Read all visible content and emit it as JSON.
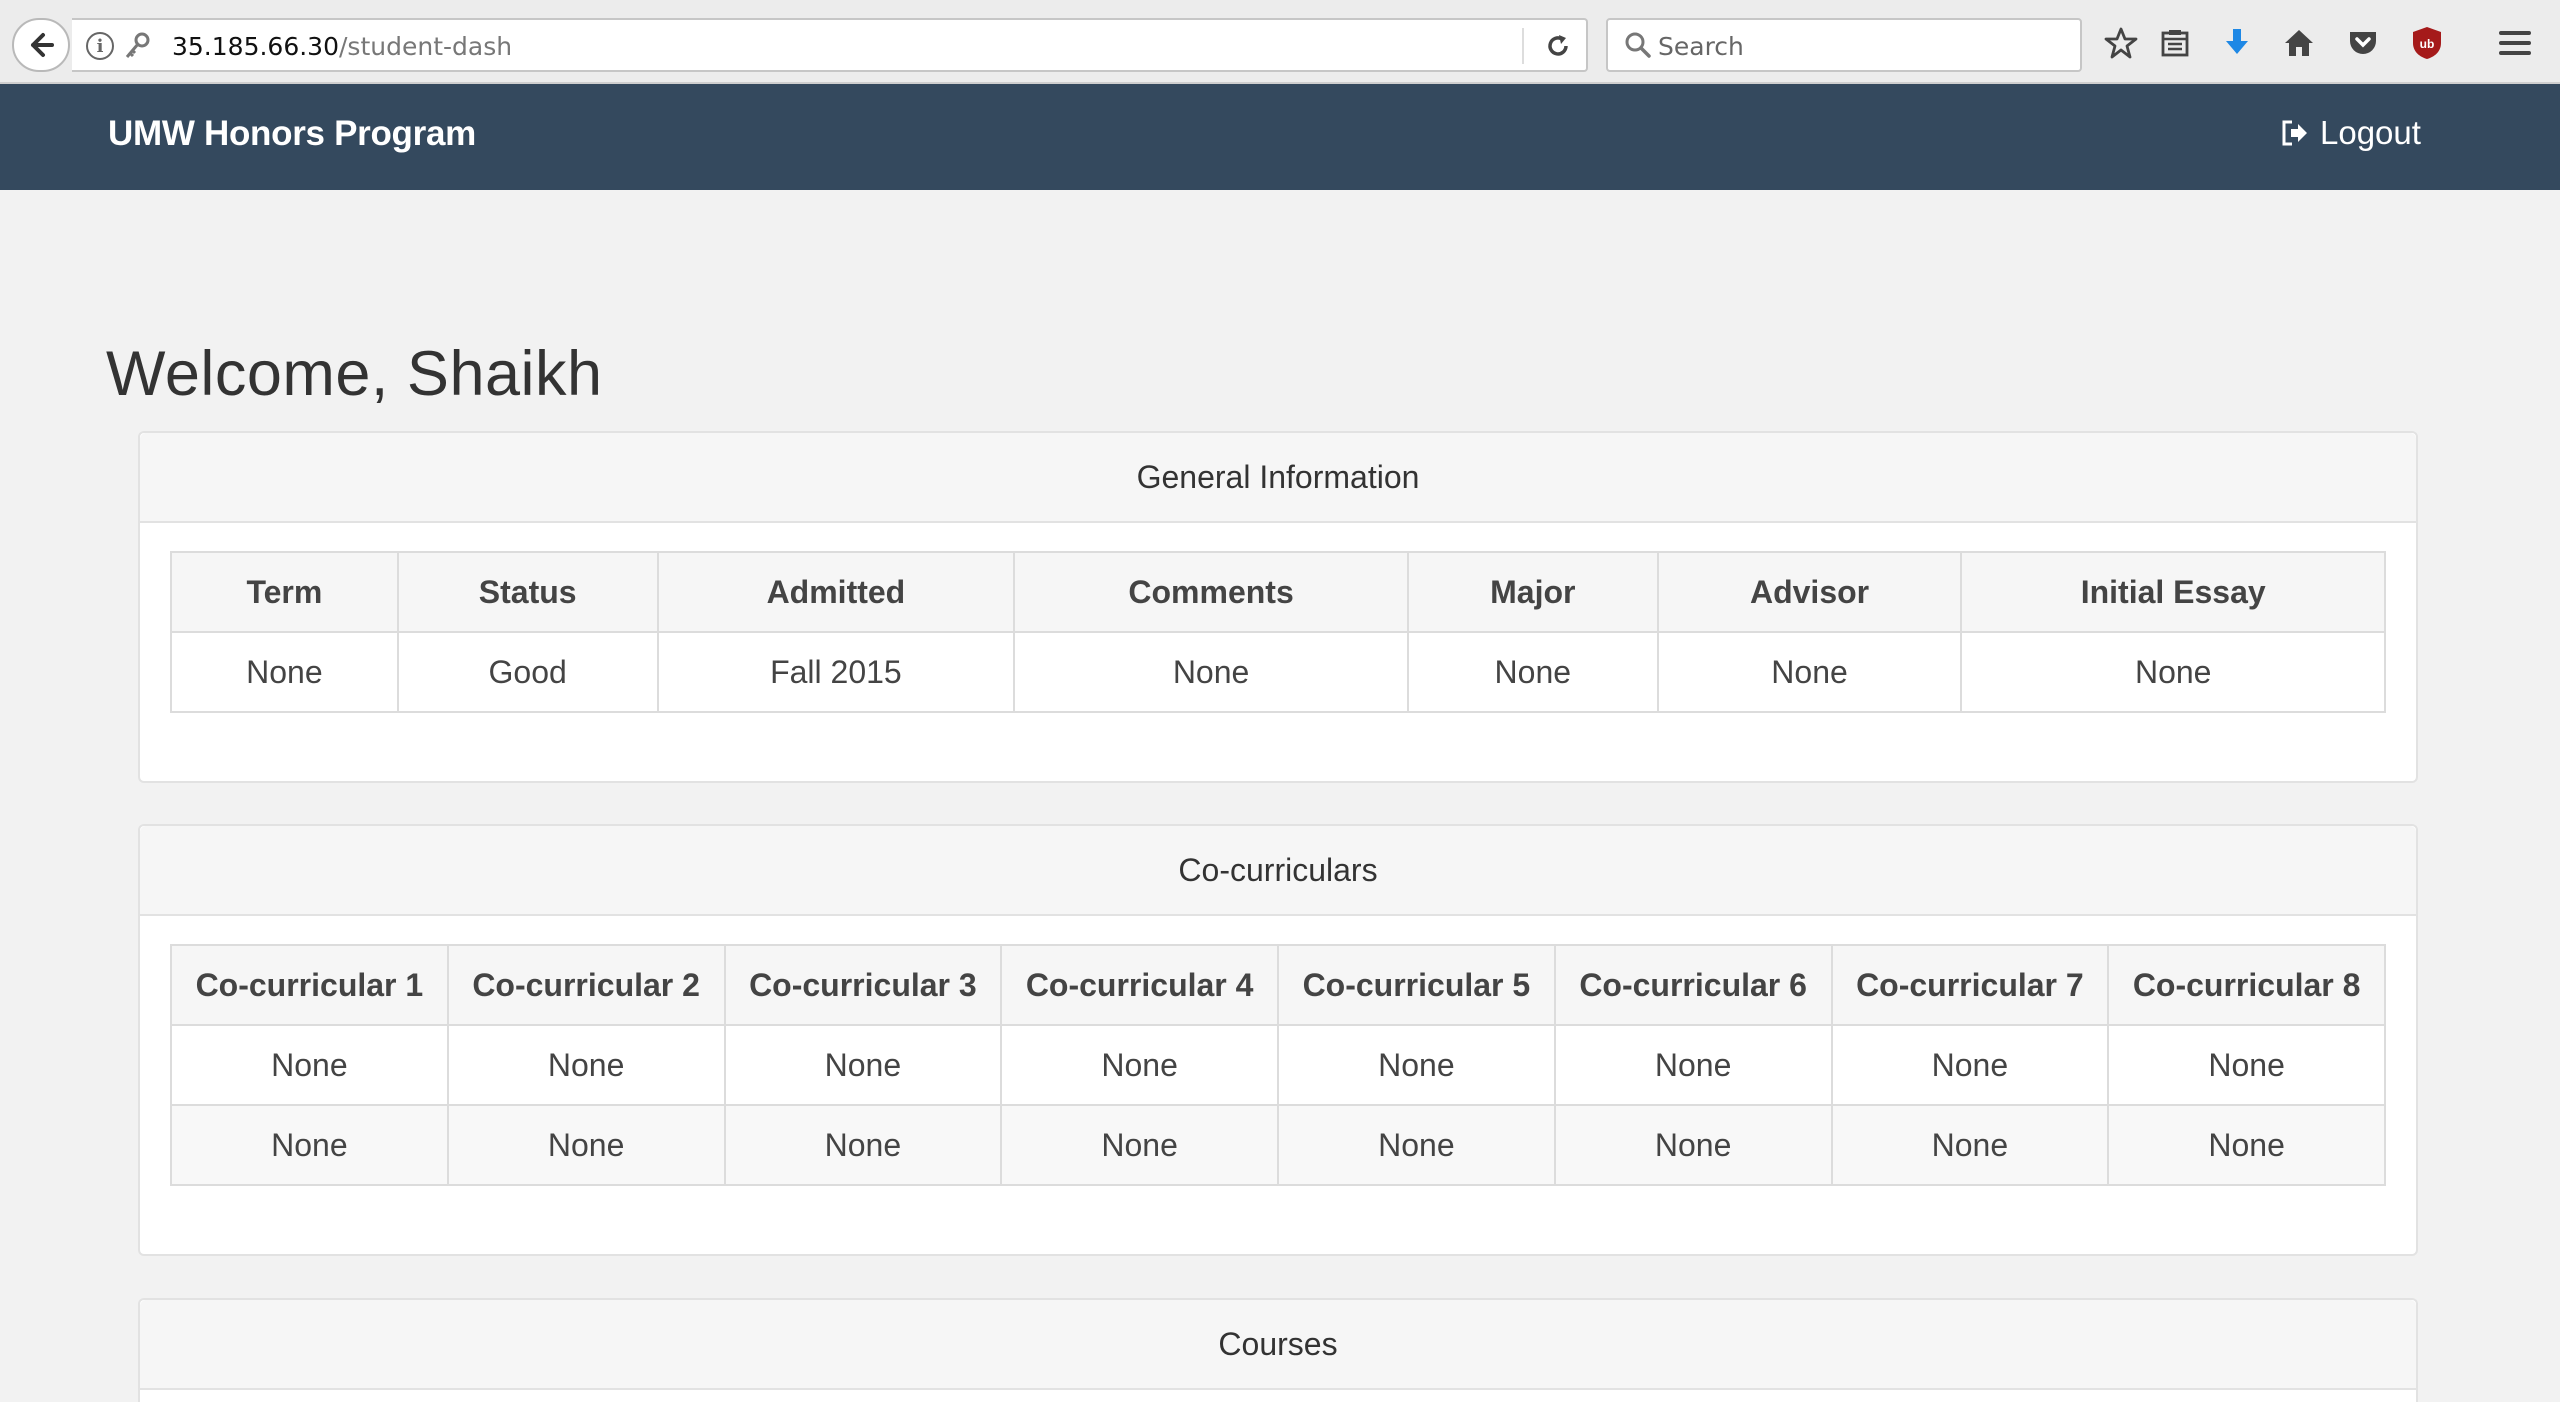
{
  "browser": {
    "url_host": "35.185.66.30",
    "url_path": "/student-dash",
    "search_placeholder": "Search",
    "toolbar_icons": [
      "star-icon",
      "reading-list-icon",
      "download-icon",
      "home-icon",
      "pocket-icon",
      "ublock-icon",
      "menu-icon"
    ],
    "download_color": "#1e88e5",
    "ublock_color": "#a51a1a"
  },
  "navbar": {
    "brand": "UMW Honors Program",
    "logout_label": "Logout",
    "bg_color": "#34495e"
  },
  "welcome": "Welcome, Shaikh",
  "general_info": {
    "title": "General Information",
    "headers": [
      "Term",
      "Status",
      "Admitted",
      "Comments",
      "Major",
      "Advisor",
      "Initial Essay"
    ],
    "rows": [
      [
        "None",
        "Good",
        "Fall 2015",
        "None",
        "None",
        "None",
        "None"
      ]
    ]
  },
  "cocurriculars": {
    "title": "Co-curriculars",
    "headers": [
      "Co-curricular 1",
      "Co-curricular 2",
      "Co-curricular 3",
      "Co-curricular 4",
      "Co-curricular 5",
      "Co-curricular 6",
      "Co-curricular 7",
      "Co-curricular 8"
    ],
    "rows": [
      [
        "None",
        "None",
        "None",
        "None",
        "None",
        "None",
        "None",
        "None"
      ],
      [
        "None",
        "None",
        "None",
        "None",
        "None",
        "None",
        "None",
        "None"
      ]
    ]
  },
  "courses": {
    "title": "Courses"
  }
}
